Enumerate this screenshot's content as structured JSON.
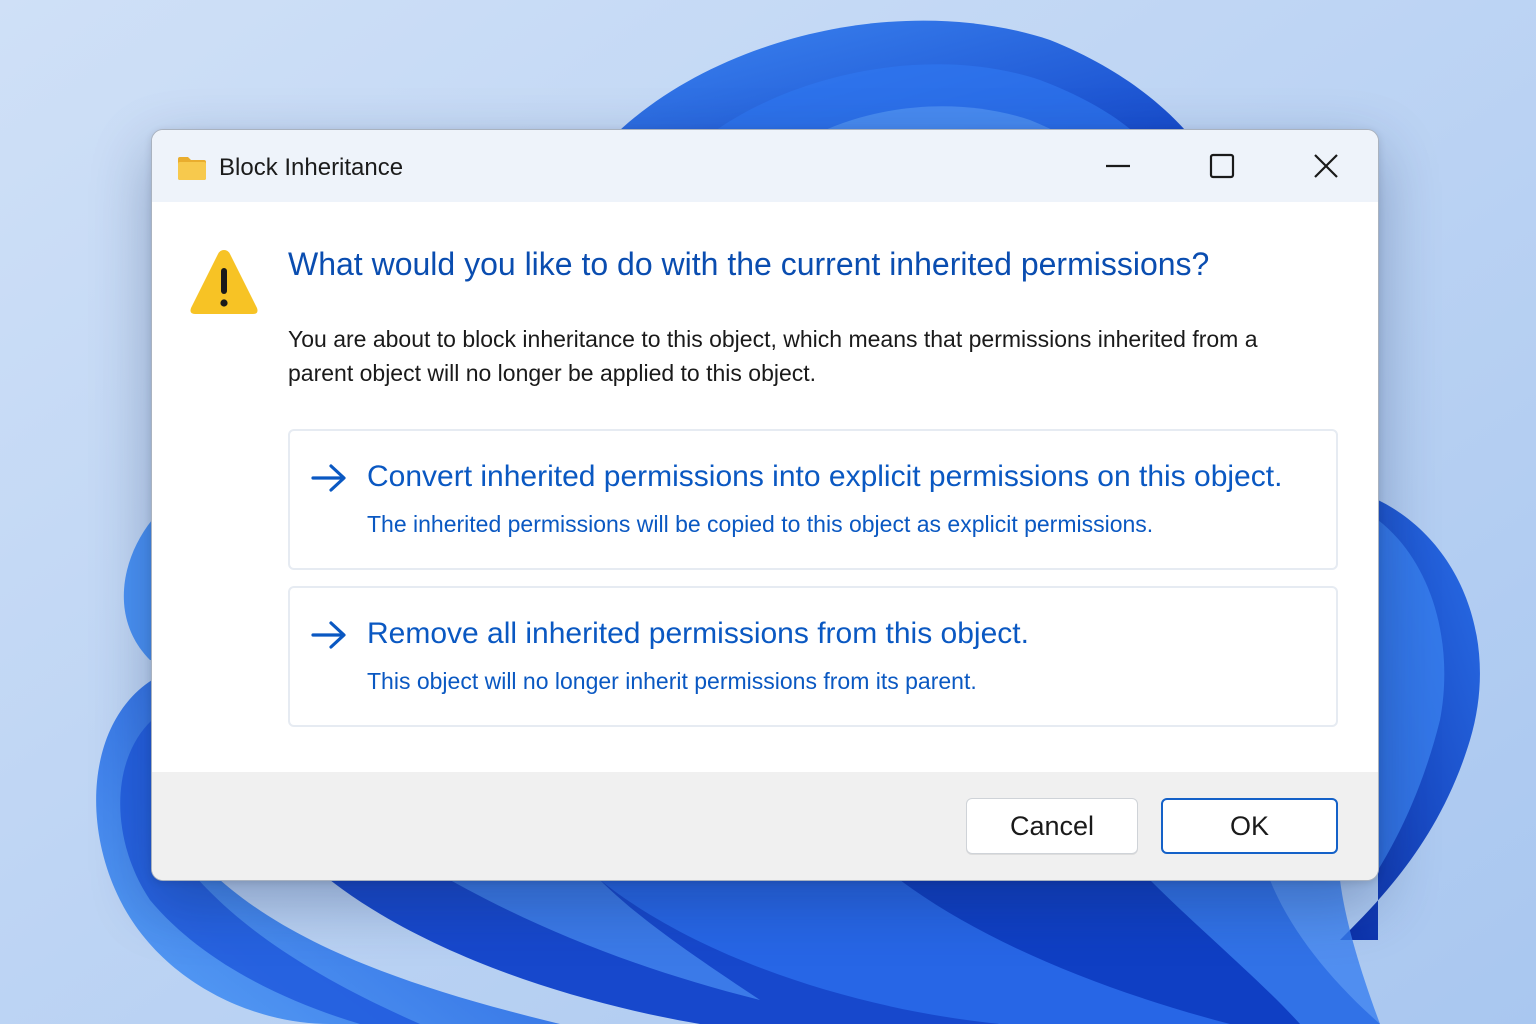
{
  "window": {
    "title": "Block Inheritance",
    "icon": "folder-icon",
    "controls": {
      "minimize_icon": "minimize-icon",
      "maximize_icon": "maximize-icon",
      "close_icon": "close-icon"
    }
  },
  "content": {
    "warning_icon": "warning-icon",
    "heading": "What would you like to do with the current inherited permissions?",
    "description": "You are about to block inheritance to this object, which means that permissions inherited from a parent object will no longer be applied to this object."
  },
  "options": [
    {
      "icon": "arrow-right-icon",
      "title": "Convert inherited permissions into explicit permissions on this object.",
      "subtitle": "The inherited permissions will be copied to this object as explicit permissions."
    },
    {
      "icon": "arrow-right-icon",
      "title": "Remove all inherited permissions from this object.",
      "subtitle": "This object will no longer inherit permissions from its parent."
    }
  ],
  "buttons": {
    "cancel": "Cancel",
    "ok": "OK"
  },
  "colors": {
    "accent": "#0a58c2",
    "heading": "#0a4db0",
    "warning": "#f7c325",
    "folder": "#f5c54a",
    "wallpaper_bg": "#b9d3f3",
    "bloom": "#1c5fe0"
  }
}
